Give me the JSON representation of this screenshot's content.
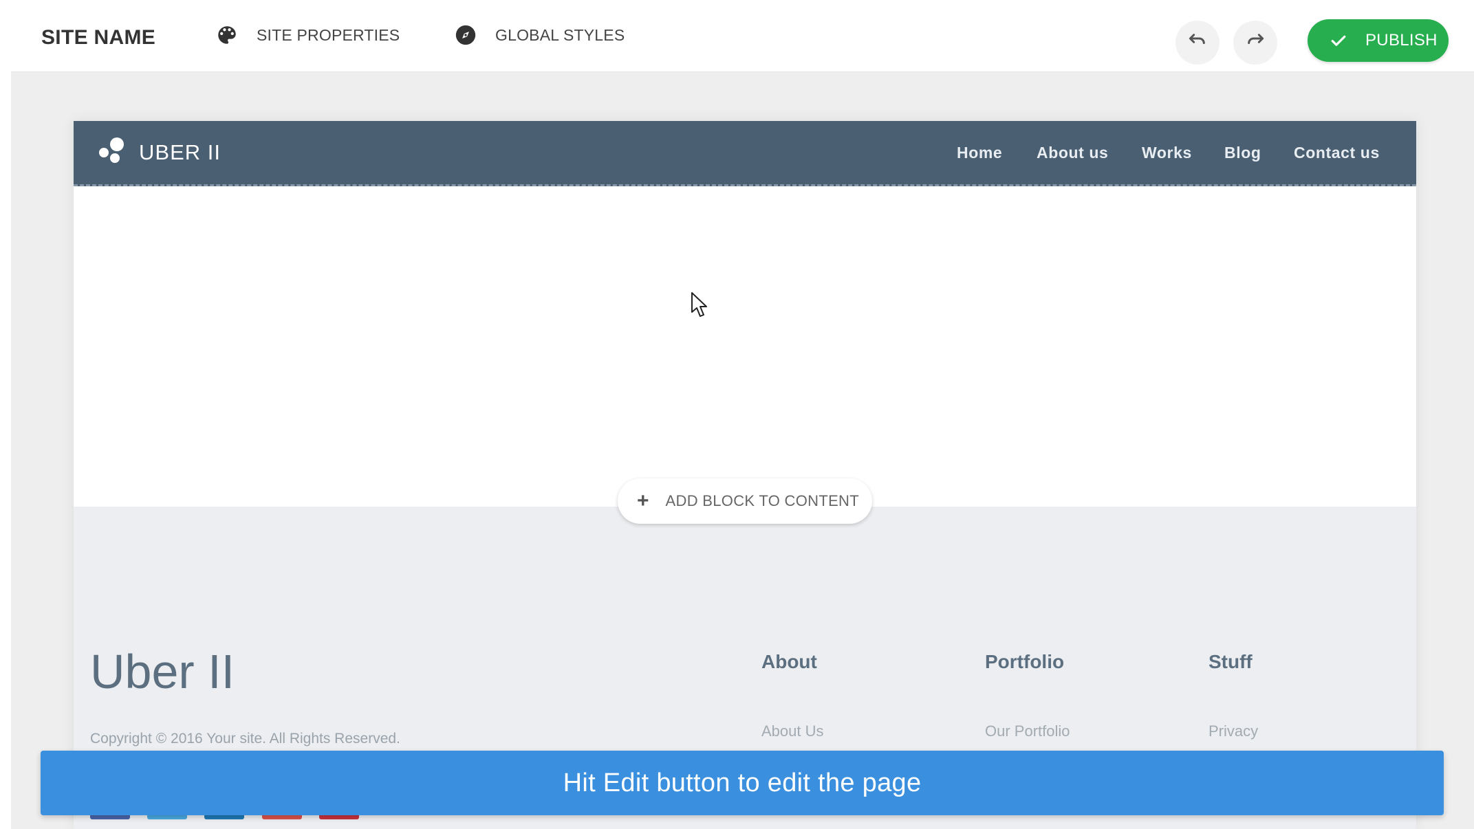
{
  "topbar": {
    "site_name": "SITE NAME",
    "site_properties_label": "SITE PROPERTIES",
    "site_properties_icon": "palette-icon",
    "global_styles_label": "GLOBAL STYLES",
    "global_styles_icon": "compass-icon",
    "undo_icon": "undo-icon",
    "redo_icon": "redo-icon",
    "publish_label": "PUBLISH",
    "publish_color": "#27ae4f"
  },
  "site_nav": {
    "brand": "UBER II",
    "links": [
      "Home",
      "About us",
      "Works",
      "Blog",
      "Contact us"
    ],
    "background": "#4a5f72"
  },
  "content": {
    "add_block_label": "ADD BLOCK TO CONTENT"
  },
  "footer": {
    "title": "Uber II",
    "copyright": "Copyright © 2016 Your site. All Rights Reserved.",
    "columns": [
      {
        "heading": "About",
        "link": "About Us"
      },
      {
        "heading": "Portfolio",
        "link": "Our Portfolio"
      },
      {
        "heading": "Stuff",
        "link": "Privacy"
      }
    ]
  },
  "banner": {
    "text": "Hit Edit button to edit the page",
    "color": "#3a8fde"
  }
}
